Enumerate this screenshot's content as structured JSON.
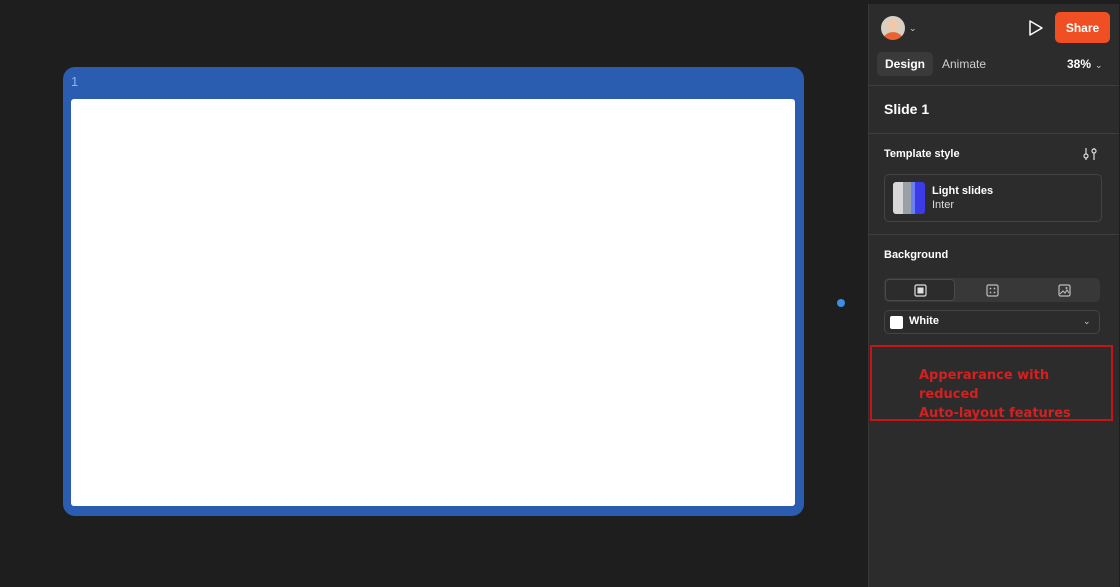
{
  "canvas": {
    "slide_number": "1"
  },
  "header": {
    "share_label": "Share",
    "avatar_icon": "user-avatar",
    "play_icon": "play-icon"
  },
  "tabs": {
    "design": "Design",
    "animate": "Animate",
    "zoom": "38%"
  },
  "properties": {
    "slide_title": "Slide 1",
    "template_section": "Template style",
    "template_name": "Light slides",
    "template_font": "Inter",
    "background_section": "Background",
    "background_value": "White",
    "background_color": "#FFFFFF"
  },
  "annotation": {
    "line1": "Apperarance with reduced",
    "line2": "Auto-layout features"
  },
  "colors": {
    "accent": "#F04E23",
    "selection": "#2A5DB0",
    "annotation": "#C81414"
  }
}
